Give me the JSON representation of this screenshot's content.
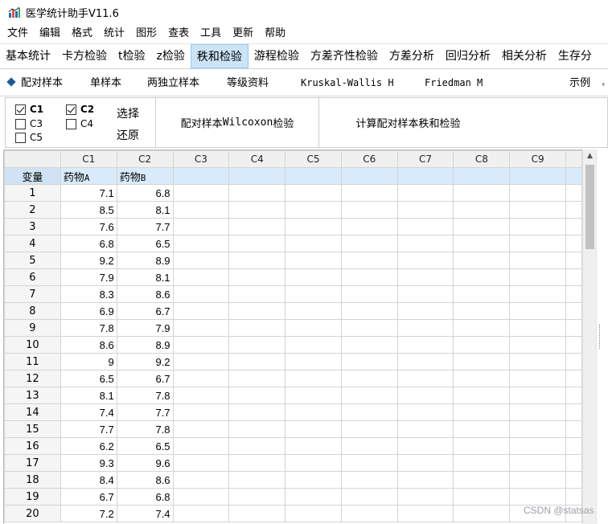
{
  "window": {
    "title": "医学统计助手V11.6",
    "icon": "bar-chart-icon"
  },
  "menu": [
    "文件",
    "编辑",
    "格式",
    "统计",
    "图形",
    "查表",
    "工具",
    "更新",
    "帮助"
  ],
  "tabs": [
    {
      "label": "基本统计",
      "active": false
    },
    {
      "label": "卡方检验",
      "active": false
    },
    {
      "label": "t检验",
      "active": false
    },
    {
      "label": "z检验",
      "active": false
    },
    {
      "label": "秩和检验",
      "active": true
    },
    {
      "label": "游程检验",
      "active": false
    },
    {
      "label": "方差齐性检验",
      "active": false
    },
    {
      "label": "方差分析",
      "active": false
    },
    {
      "label": "回归分析",
      "active": false
    },
    {
      "label": "相关分析",
      "active": false
    },
    {
      "label": "生存分",
      "active": false
    }
  ],
  "subtabs": {
    "paired": "配对样本",
    "single": "单样本",
    "two_indep": "两独立样本",
    "ordinal": "等级资料",
    "kruskal": "Kruskal-Wallis H",
    "friedman": "Friedman M",
    "example": "示例"
  },
  "panel": {
    "checkboxes": [
      {
        "label": "C1",
        "checked": true
      },
      {
        "label": "C2",
        "checked": true
      },
      {
        "label": "C3",
        "checked": false
      },
      {
        "label": "C4",
        "checked": false
      },
      {
        "label": "C5",
        "checked": false
      }
    ],
    "select_label": "选择",
    "restore_label": "还原",
    "wilcoxon_pre": "配对样本",
    "wilcoxon_word": "Wilcoxon",
    "wilcoxon_post": "检验",
    "compute_label": "计算配对样本秩和检验"
  },
  "grid": {
    "columns": [
      "C1",
      "C2",
      "C3",
      "C4",
      "C5",
      "C6",
      "C7",
      "C8",
      "C9"
    ],
    "var_header": "变量",
    "var_names": [
      {
        "name": "药物",
        "suffix": "A"
      },
      {
        "name": "药物",
        "suffix": "B"
      }
    ],
    "rows": [
      [
        "1",
        "7.1",
        "6.8"
      ],
      [
        "2",
        "8.5",
        "8.1"
      ],
      [
        "3",
        "7.6",
        "7.7"
      ],
      [
        "4",
        "6.8",
        "6.5"
      ],
      [
        "5",
        "9.2",
        "8.9"
      ],
      [
        "6",
        "7.9",
        "8.1"
      ],
      [
        "7",
        "8.3",
        "8.6"
      ],
      [
        "8",
        "6.9",
        "6.7"
      ],
      [
        "9",
        "7.8",
        "7.9"
      ],
      [
        "10",
        "8.6",
        "8.9"
      ],
      [
        "11",
        "9",
        "9.2"
      ],
      [
        "12",
        "6.5",
        "6.7"
      ],
      [
        "13",
        "8.1",
        "7.8"
      ],
      [
        "14",
        "7.4",
        "7.7"
      ],
      [
        "15",
        "7.7",
        "7.8"
      ],
      [
        "16",
        "6.2",
        "6.5"
      ],
      [
        "17",
        "9.3",
        "9.6"
      ],
      [
        "18",
        "8.4",
        "8.6"
      ],
      [
        "19",
        "6.7",
        "6.8"
      ],
      [
        "20",
        "7.2",
        "7.4"
      ]
    ]
  },
  "watermark": "CSDN @statsas",
  "colors": {
    "active_tab": "#cce4f7",
    "var_row": "#d9ebfa",
    "accent": "#1f5a96"
  }
}
